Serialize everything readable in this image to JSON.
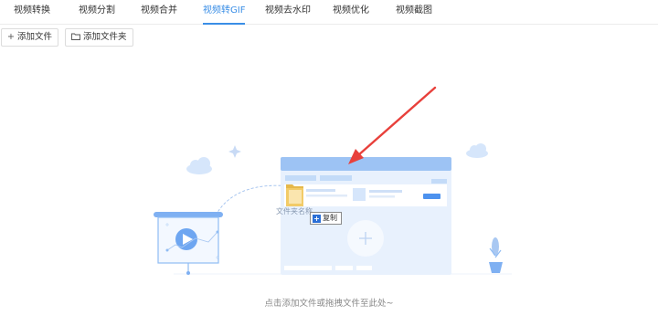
{
  "tabs": [
    {
      "label": "视频转换",
      "active": false
    },
    {
      "label": "视频分割",
      "active": false
    },
    {
      "label": "视频合并",
      "active": false
    },
    {
      "label": "视频转GIF",
      "active": true
    },
    {
      "label": "视频去水印",
      "active": false
    },
    {
      "label": "视频优化",
      "active": false
    },
    {
      "label": "视频截图",
      "active": false
    }
  ],
  "toolbar": {
    "add_file_label": "添加文件",
    "add_folder_label": "添加文件夹",
    "add_file_icon": "plus-icon",
    "add_folder_icon": "folder-icon"
  },
  "dropzone": {
    "drag_item_label": "文件夹名称",
    "copy_tooltip": "复制",
    "hint": "点击添加文件或拖拽文件至此处~"
  },
  "colors": {
    "accent": "#3a8ee6",
    "illustration_light": "#e3eefc",
    "illustration_mid": "#a9c8f2",
    "arrow": "#e8403b"
  }
}
